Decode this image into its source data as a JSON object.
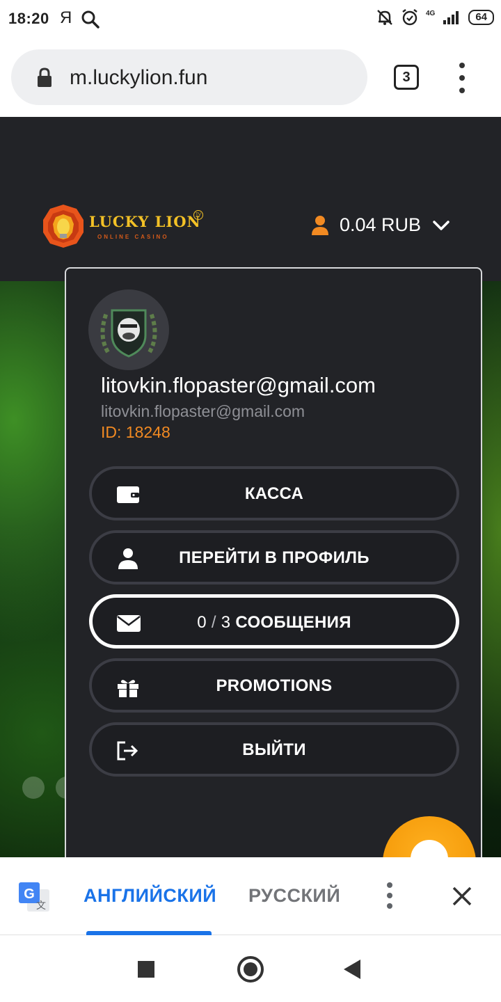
{
  "status_bar": {
    "time": "18:20",
    "ya_label": "Я",
    "network_label": "4G",
    "battery": "64"
  },
  "browser": {
    "url": "m.luckylion.fun",
    "tab_count": "3"
  },
  "site": {
    "logo_text": "LUCKY LION",
    "logo_subtitle": "ONLINE CASINO",
    "logo_tv": "TV",
    "balance": "0.04 RUB"
  },
  "profile": {
    "display_name": "litovkin.flopaster@gmail.com",
    "email": "litovkin.flopaster@gmail.com",
    "id_label": "ID: 18248"
  },
  "menu": {
    "cashier": "КАССА",
    "profile": "ПЕРЕЙТИ В ПРОФИЛЬ",
    "messages_read": "0",
    "messages_sep": "/",
    "messages_total": "3",
    "messages_label": "СООБЩЕНИЯ",
    "promotions": "PROMOTIONS",
    "logout": "ВЫЙТИ"
  },
  "translate": {
    "source_lang": "АНГЛИЙСКИЙ",
    "target_lang": "РУССКИЙ"
  },
  "colors": {
    "accent_orange": "#f28a22",
    "translate_blue": "#1a73e8",
    "panel_bg": "#222327"
  }
}
